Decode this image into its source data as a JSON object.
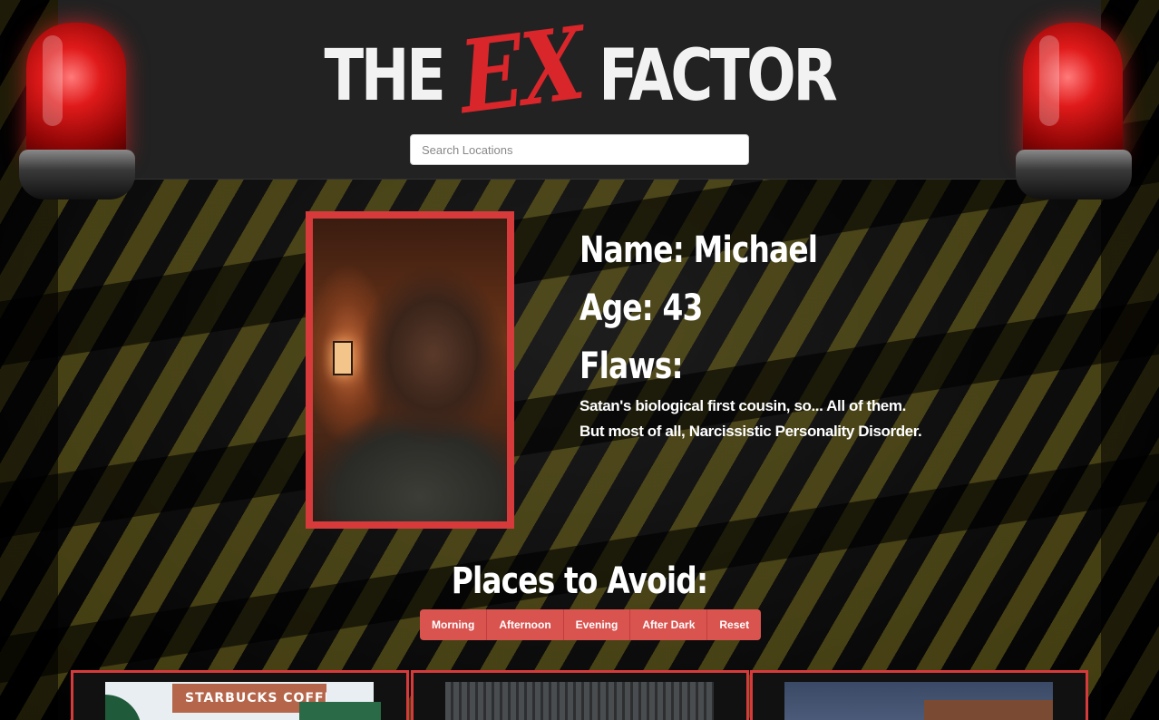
{
  "header": {
    "logo": {
      "part1": "THE",
      "part2": "EX",
      "part3": "FACTOR"
    },
    "search": {
      "placeholder": "Search Locations",
      "value": ""
    }
  },
  "profile": {
    "photo_icon": "profile-photo",
    "name_line": "Name: Michael",
    "age_line": "Age: 43",
    "flaws_heading": "Flaws:",
    "flaws_lines": [
      "Satan's biological first cousin, so... All of them.",
      "But most of all, Narcissistic Personality Disorder."
    ]
  },
  "places": {
    "title": "Places to Avoid:",
    "filters": [
      "Morning",
      "Afternoon",
      "Evening",
      "After Dark",
      "Reset"
    ],
    "cards": [
      {
        "sign_text": "STARBUCKS COFFEE"
      },
      {
        "sign_text": ""
      },
      {
        "sign_text": ""
      }
    ]
  },
  "colors": {
    "accent_red": "#d73a3a",
    "button_red": "#d9534f",
    "header_bg": "#222222",
    "tape_yellow": "#786e1e"
  },
  "icons": {
    "left": "siren-light-icon",
    "right": "siren-light-icon"
  }
}
